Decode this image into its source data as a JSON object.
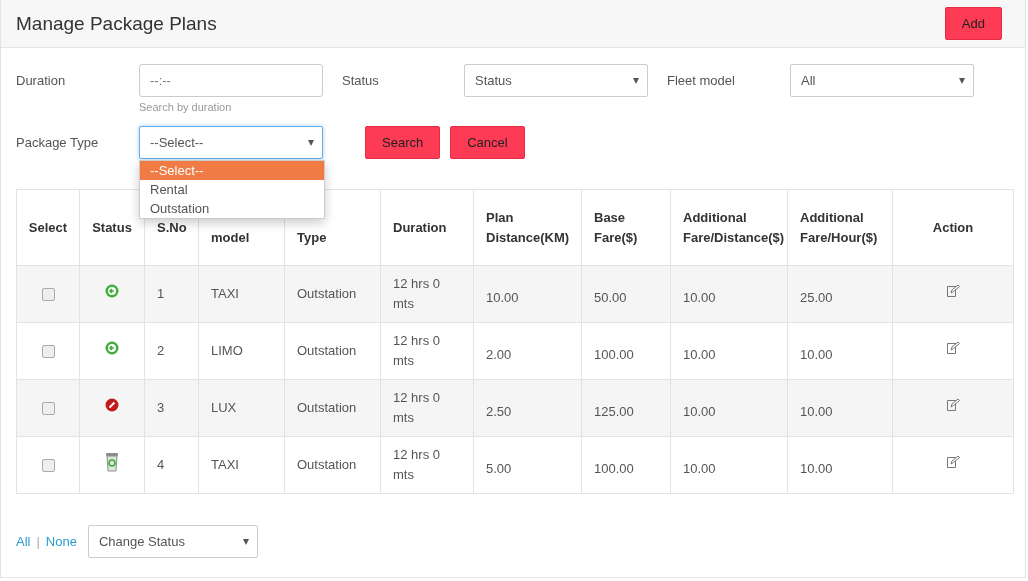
{
  "header": {
    "title": "Manage Package Plans",
    "add_button": "Add"
  },
  "filters": {
    "duration": {
      "label": "Duration",
      "placeholder": "--:--",
      "hint": "Search by duration"
    },
    "status": {
      "label": "Status",
      "value": "Status"
    },
    "fleet_model": {
      "label": "Fleet model",
      "value": "All"
    },
    "package_type": {
      "label": "Package Type",
      "value": "--Select--",
      "expanded": true,
      "options": [
        {
          "label": "--Select--",
          "selected": true
        },
        {
          "label": "Rental",
          "selected": false
        },
        {
          "label": "Outstation",
          "selected": false
        }
      ]
    },
    "search_button": "Search",
    "cancel_button": "Cancel"
  },
  "table": {
    "columns": [
      "Select",
      "Status",
      "S.No",
      "model",
      "Type",
      "Duration",
      "Plan Distance(KM)",
      "Base Fare($)",
      "Additional Fare/Distance($)",
      "Additional Fare/Hour($)",
      "Action"
    ],
    "rows": [
      {
        "checked": false,
        "kind": "active",
        "sno": "1",
        "fleet_model": "TAXI",
        "package_type": "Outstation",
        "duration": "12 hrs 0 mts",
        "plan_distance": "10.00",
        "base_fare": "50.00",
        "additional_fare_distance": "10.00",
        "additional_fare_hour": "25.00"
      },
      {
        "checked": false,
        "kind": "active",
        "sno": "2",
        "fleet_model": "LIMO",
        "package_type": "Outstation",
        "duration": "12 hrs 0 mts",
        "plan_distance": "2.00",
        "base_fare": "100.00",
        "additional_fare_distance": "10.00",
        "additional_fare_hour": "10.00"
      },
      {
        "checked": false,
        "kind": "inactive",
        "sno": "3",
        "fleet_model": "LUX",
        "package_type": "Outstation",
        "duration": "12 hrs 0 mts",
        "plan_distance": "2.50",
        "base_fare": "125.00",
        "additional_fare_distance": "10.00",
        "additional_fare_hour": "10.00"
      },
      {
        "checked": false,
        "kind": "deleted",
        "sno": "4",
        "fleet_model": "TAXI",
        "package_type": "Outstation",
        "duration": "12 hrs 0 mts",
        "plan_distance": "5.00",
        "base_fare": "100.00",
        "additional_fare_distance": "10.00",
        "additional_fare_hour": "10.00"
      }
    ]
  },
  "footer": {
    "all_link": "All",
    "separator": "|",
    "none_link": "None",
    "change_status": "Change Status"
  }
}
